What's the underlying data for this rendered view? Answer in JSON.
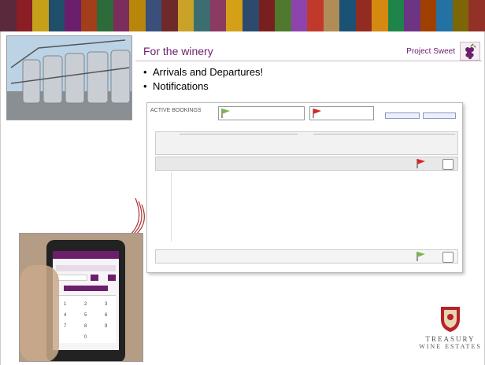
{
  "colors": {
    "stripes": [
      "#5a2a3c",
      "#8b1d24",
      "#c7a01a",
      "#1f4f6b",
      "#6b1e6b",
      "#a33e1a",
      "#2e6b3a",
      "#7b2d5b",
      "#b8860b",
      "#3a4f7a",
      "#6e2a2a",
      "#c9a227",
      "#3c6e71",
      "#8b3a62",
      "#d4a017",
      "#2c4a6e",
      "#7a1f1f",
      "#4f7a2e",
      "#8e44ad",
      "#c0392b",
      "#b08d57",
      "#1a5276",
      "#922b21",
      "#d68910",
      "#1e8449",
      "#6c3483",
      "#a04000",
      "#2471a3",
      "#7d6608",
      "#943126"
    ],
    "accent": "#6b1e6b"
  },
  "slide": {
    "title": "For the winery",
    "project_label": "Project Sweet",
    "bullets": [
      "Arrivals and Departures!",
      "Notifications"
    ]
  },
  "screen": {
    "heading": "ACTIVE BOOKINGS"
  },
  "logo": {
    "line1": "TREASURY",
    "line2": "WINE ESTATES"
  },
  "icons": {
    "grape": "grape-icon",
    "flag": "flag-icon",
    "document": "document-icon"
  }
}
